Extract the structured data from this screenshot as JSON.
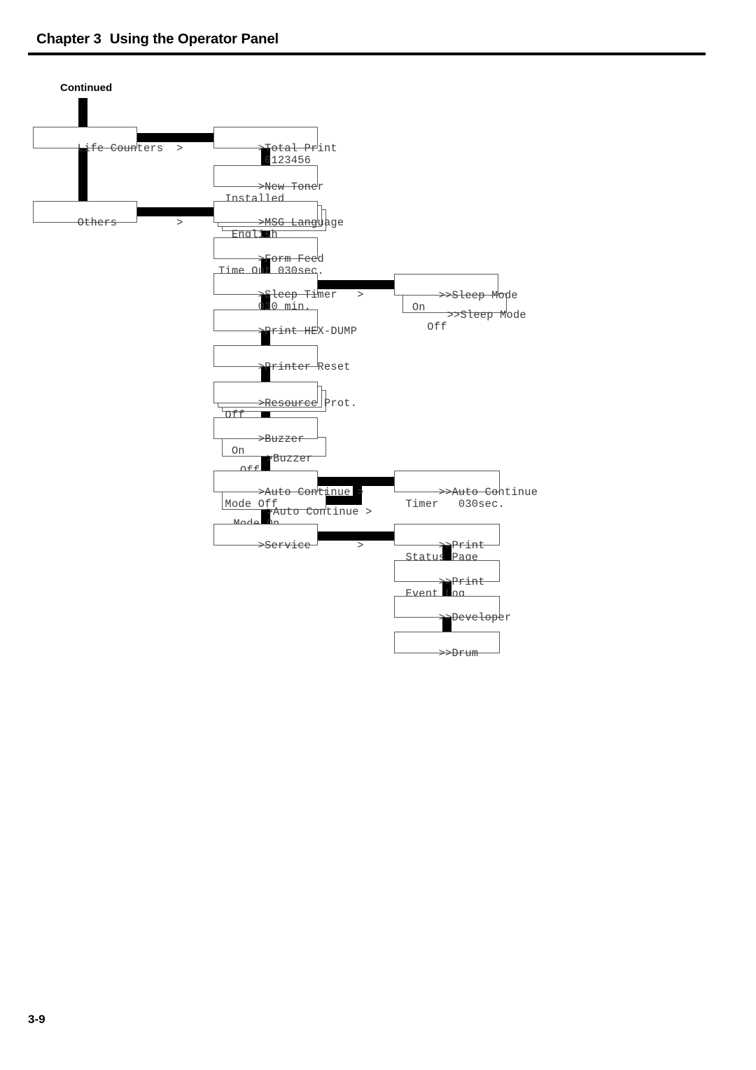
{
  "header": {
    "chapter": "Chapter 3",
    "title": "Using the Operator Panel"
  },
  "footer": {
    "page_number": "3-9"
  },
  "flow": {
    "entry_label": "Continued",
    "column1": [
      {
        "name": "life-counters",
        "line1": "Life Counters  >",
        "line2": ""
      },
      {
        "name": "others",
        "line1": "Others         >",
        "line2": ""
      }
    ],
    "column2": [
      {
        "name": "total-print",
        "line1": ">Total Print",
        "line2": "       0123456"
      },
      {
        "name": "new-toner",
        "line1": ">New Toner",
        "line2": " Installed"
      },
      {
        "name": "msg-language",
        "line1": ">MSG Language",
        "line2": "  English"
      },
      {
        "name": "form-feed",
        "line1": ">Form Feed",
        "line2": "Time Out 030sec."
      },
      {
        "name": "sleep-timer",
        "line1": ">Sleep Timer   >",
        "line2": "      030 min."
      },
      {
        "name": "print-hex-dump",
        "line1": ">Print HEX-DUMP",
        "line2": ""
      },
      {
        "name": "printer-reset",
        "line1": ">Printer Reset",
        "line2": ""
      },
      {
        "name": "resource-prot",
        "line1": ">Resource Prot.",
        "line2": " Off"
      },
      {
        "name": "buzzer-on",
        "line1": ">Buzzer",
        "line2": "  On"
      },
      {
        "name": "buzzer-off",
        "line1": ">Buzzer",
        "line2": "  Off"
      },
      {
        "name": "auto-continue-mode-off",
        "line1": ">Auto Continue >",
        "line2": " Mode Off"
      },
      {
        "name": "auto-continue-mode-on",
        "line1": ">Auto Continue >",
        "line2": " Mode On"
      },
      {
        "name": "service",
        "line1": ">Service       >",
        "line2": ""
      }
    ],
    "column3": [
      {
        "name": "sleep-mode-on",
        "line1": ">>Sleep Mode",
        "line2": "  On"
      },
      {
        "name": "sleep-mode-off",
        "line1": ">>Sleep Mode",
        "line2": "   Off"
      },
      {
        "name": "auto-continue-timer",
        "line1": ">>Auto Continue",
        "line2": " Timer   030sec."
      },
      {
        "name": "print-status-page",
        "line1": ">>Print",
        "line2": " Status Page"
      },
      {
        "name": "print-event-log",
        "line1": ">>Print",
        "line2": " Event Log"
      },
      {
        "name": "developer",
        "line1": ">>Developer",
        "line2": ""
      },
      {
        "name": "drum",
        "line1": ">>Drum",
        "line2": ""
      }
    ]
  },
  "colors": {
    "ink": "#000000",
    "box_border": "#58585a",
    "lcd_text": "#3b3b3d",
    "paper": "#ffffff"
  }
}
